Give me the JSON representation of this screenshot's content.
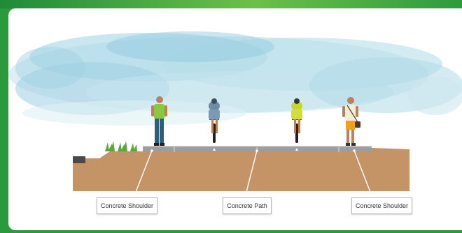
{
  "labels": {
    "left_shoulder": "Concrete Shoulder",
    "path": "Concrete Path",
    "right_shoulder": "Concrete Shoulder"
  },
  "colors": {
    "frame_border": "#2a9a3c",
    "sky": "#a9d8e6",
    "soil": "#c49466",
    "concrete": "#9a9a9a",
    "grass": "#5aa83a"
  },
  "figures": [
    {
      "id": "pedestrian-left",
      "icon": "walking-man-green-shirt"
    },
    {
      "id": "cyclist-left",
      "icon": "cyclist-blue-jersey"
    },
    {
      "id": "cyclist-right",
      "icon": "cyclist-yellow-jersey"
    },
    {
      "id": "pedestrian-right",
      "icon": "walking-man-satchel"
    }
  ]
}
